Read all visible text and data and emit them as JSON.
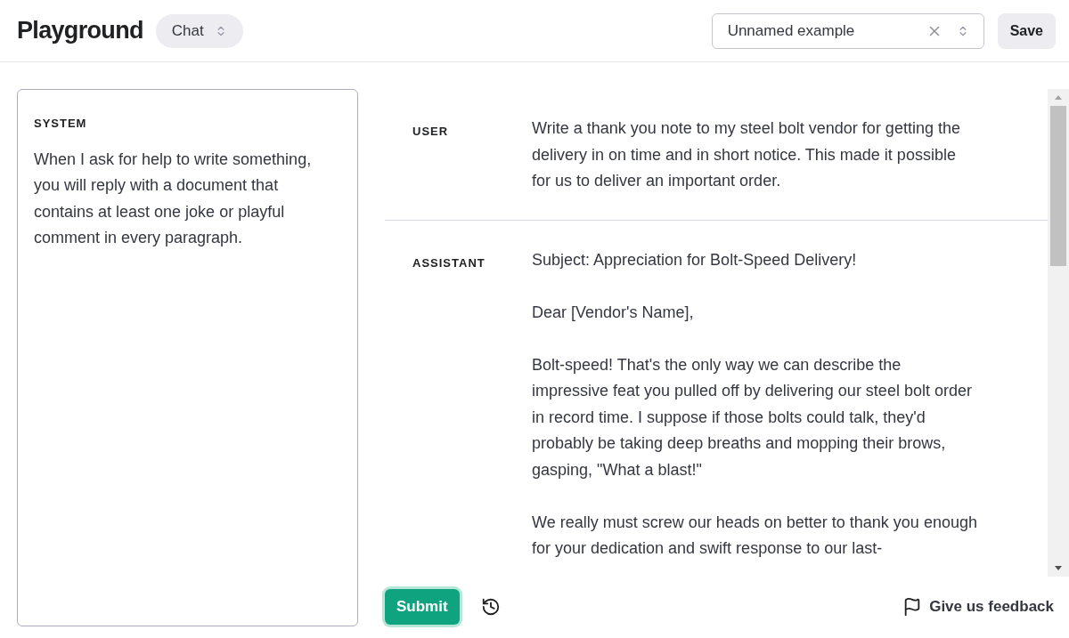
{
  "header": {
    "title": "Playground",
    "mode_select": {
      "value": "Chat"
    },
    "preset_select": {
      "value": "Unnamed example"
    },
    "save_button": "Save"
  },
  "system": {
    "label": "SYSTEM",
    "text": "When I ask for help to write something, you will reply with a document that contains at least one joke or playful comment in every paragraph."
  },
  "messages": [
    {
      "role": "USER",
      "paragraphs": [
        "Write a thank you note to my steel bolt vendor for getting the delivery in on time and in short notice. This made it possible for us to deliver an important order."
      ]
    },
    {
      "role": "ASSISTANT",
      "paragraphs": [
        "Subject: Appreciation for Bolt-Speed Delivery!",
        "Dear [Vendor's Name],",
        "Bolt-speed! That's the only way we can describe the impressive feat you pulled off by delivering our steel bolt order in record time. I suppose if those bolts could talk, they'd probably be taking deep breaths and mopping their brows, gasping, \"What a blast!\"",
        "We really must screw our heads on better to thank you enough for your dedication and swift response to our last-"
      ]
    }
  ],
  "footer": {
    "submit_button": "Submit",
    "feedback_link": "Give us feedback"
  }
}
